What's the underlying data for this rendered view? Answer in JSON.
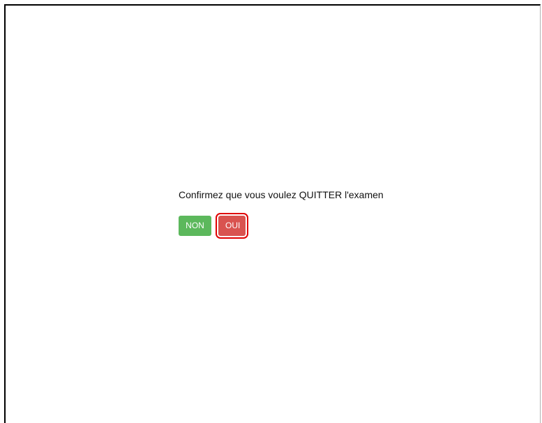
{
  "dialog": {
    "message": "Confirmez que vous voulez QUITTER l'examen",
    "no_label": "NON",
    "yes_label": "OUI"
  },
  "colors": {
    "no_button": "#5cb85c",
    "yes_button": "#d9534f",
    "highlight_ring": "#e00000"
  }
}
